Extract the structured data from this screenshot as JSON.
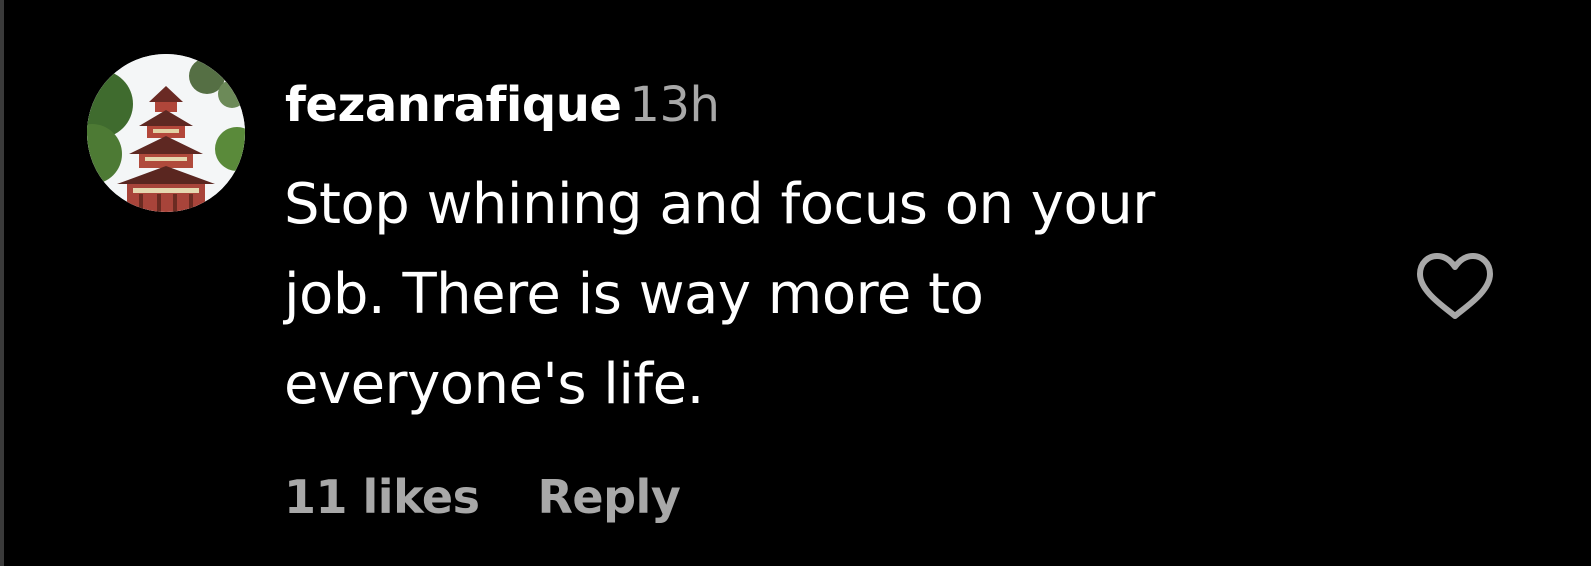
{
  "comment": {
    "username": "fezanrafique",
    "timestamp": "13h",
    "text": "Stop whining and focus on your\njob. There is way more to\neveryone's life.",
    "likes_label": "11 likes",
    "reply_label": "Reply",
    "avatar_icon": "avatar-pagoda-image",
    "like_icon": "heart-outline-icon"
  },
  "colors": {
    "background": "#000000",
    "text": "#ffffff",
    "muted": "#a8a8a8"
  }
}
